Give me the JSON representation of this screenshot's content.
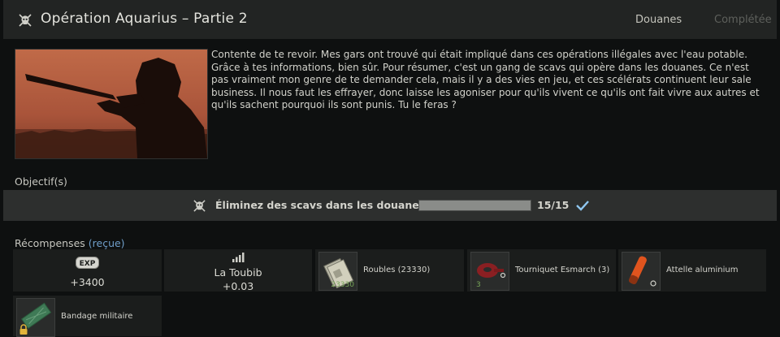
{
  "header": {
    "title": "Opération Aquarius – Partie 2",
    "location": "Douanes",
    "status": "Complétée"
  },
  "description": "Contente de te revoir. Mes gars ont trouvé qui était impliqué dans ces opérations illégales avec l'eau potable. Grâce à tes informations, bien sûr. Pour résumer, c'est un gang de scavs qui opère dans les douanes. Ce n'est pas vraiment mon genre de te demander cela, mais il y a des vies en jeu, et ces scélérats continuent leur sale business. Il nous faut les effrayer, donc laisse les agoniser pour qu'ils vivent ce qu'ils ont fait vivre aux autres et qu'ils sachent pourquoi ils sont punis. Tu le feras ?",
  "objectives": {
    "label": "Objectif(s)",
    "items": [
      {
        "icon": "skull-icon",
        "text": "Éliminez des scavs dans les douanes",
        "count": "15/15",
        "progress": 1.0,
        "completed": true
      }
    ]
  },
  "rewards": {
    "label": "Récompenses",
    "received": "(reçue)",
    "exp": {
      "badge": "EXP",
      "value": "+3400"
    },
    "trader": {
      "name": "La Toubib",
      "value": "+0.03",
      "icon": "rank-bars-icon"
    },
    "items": [
      {
        "key": "roubles",
        "name": "Roubles (23330)",
        "count": "23330",
        "icon": "roubles-stack-icon"
      },
      {
        "key": "tourniquet",
        "name": "Tourniquet Esmarch (3)",
        "count": "3",
        "icon": "tourniquet-icon"
      },
      {
        "key": "splint",
        "name": "Attelle aluminium",
        "count": "",
        "icon": "splint-icon"
      },
      {
        "key": "bandage",
        "name": "Bandage militaire",
        "count": "",
        "icon": "bandage-icon"
      }
    ]
  },
  "colors": {
    "accent_link": "#6f9ec9",
    "check": "#8fc7f0",
    "count_green": "#78a65a",
    "lock": "#e2b43a"
  }
}
